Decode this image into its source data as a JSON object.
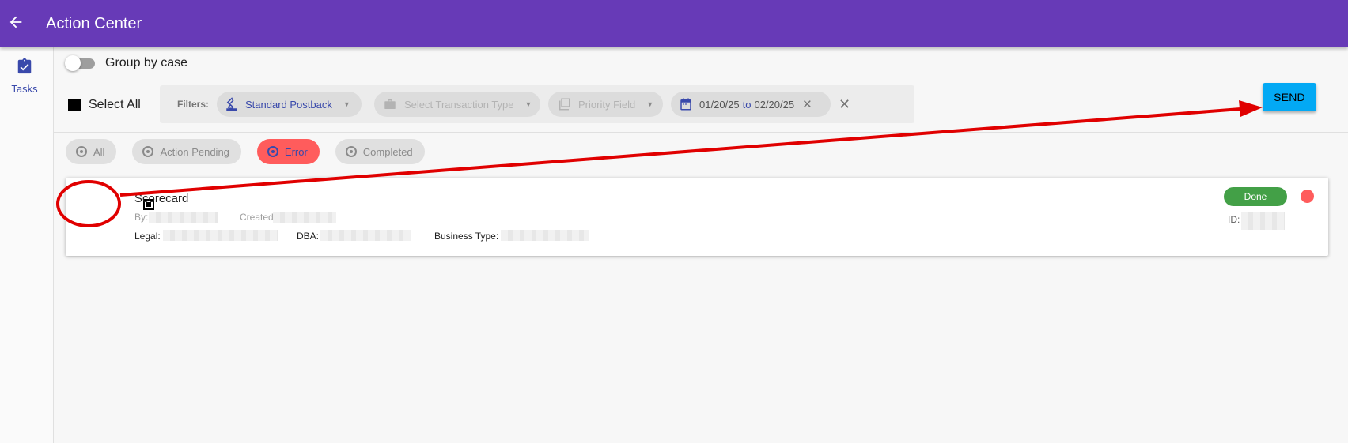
{
  "appbar": {
    "title": "Action Center"
  },
  "sidenav": {
    "tasks_label": "Tasks"
  },
  "toolbar": {
    "group_by_case_label": "Group by case",
    "select_all_label": "Select All",
    "filters_label": "Filters:",
    "filter_postback": "Standard Postback",
    "filter_transaction_placeholder": "Select Transaction Type",
    "filter_priority_placeholder": "Priority Field",
    "date_from": "01/20/25",
    "date_to_word": "to",
    "date_to": "02/20/25",
    "send_label": "SEND"
  },
  "status_tabs": [
    "All",
    "Action Pending",
    "Error",
    "Completed"
  ],
  "active_tab": "Error",
  "card": {
    "title": "Scorecard",
    "by_label": "By:",
    "created_label": "Created",
    "legal_label": "Legal:",
    "dba_label": "DBA:",
    "business_type_label": "Business Type:",
    "id_label": "ID:",
    "status_badge": "Done"
  },
  "colors": {
    "appbar": "#673ab7",
    "send": "#03a9f4",
    "error_tab": "#ff5c5c",
    "done_badge": "#43a047",
    "accent": "#3949ab",
    "annotation": "#e00000"
  }
}
